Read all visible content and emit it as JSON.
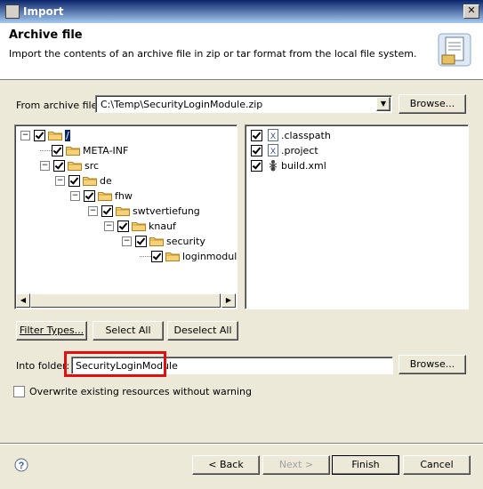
{
  "window": {
    "title": "Import"
  },
  "banner": {
    "heading": "Archive file",
    "description": "Import the contents of an archive file in zip or tar format from the local file system."
  },
  "source": {
    "label": "From archive file:",
    "value": "C:\\Temp\\SecurityLoginModule.zip",
    "browse_label": "Browse..."
  },
  "tree": [
    {
      "label": "/",
      "checked": true,
      "expanded": true,
      "selected": true
    },
    {
      "label": "META-INF",
      "checked": true
    },
    {
      "label": "src",
      "checked": true,
      "expanded": true
    },
    {
      "label": "de",
      "checked": true,
      "expanded": true
    },
    {
      "label": "fhw",
      "checked": true,
      "expanded": true
    },
    {
      "label": "swtvertiefung",
      "checked": true,
      "expanded": true
    },
    {
      "label": "knauf",
      "checked": true,
      "expanded": true
    },
    {
      "label": "security",
      "checked": true,
      "expanded": true
    },
    {
      "label": "loginmodule",
      "checked": true
    }
  ],
  "files": [
    {
      "label": ".classpath",
      "checked": true,
      "icon": "xml-file-icon"
    },
    {
      "label": ".project",
      "checked": true,
      "icon": "xml-file-icon"
    },
    {
      "label": "build.xml",
      "checked": true,
      "icon": "ant-file-icon"
    }
  ],
  "buttons": {
    "filter_types": "Filter Types...",
    "select_all": "Select All",
    "deselect_all": "Deselect All"
  },
  "destination": {
    "label": "Into folder:",
    "value": "SecurityLoginModule",
    "browse_label": "Browse..."
  },
  "overwrite": {
    "label": "Overwrite existing resources without warning",
    "checked": false
  },
  "footer": {
    "back": "< Back",
    "next": "Next >",
    "finish": "Finish",
    "cancel": "Cancel",
    "help_icon": "help-icon"
  },
  "colors": {
    "highlight_box": "#e01010",
    "selection": "#0a246a"
  }
}
